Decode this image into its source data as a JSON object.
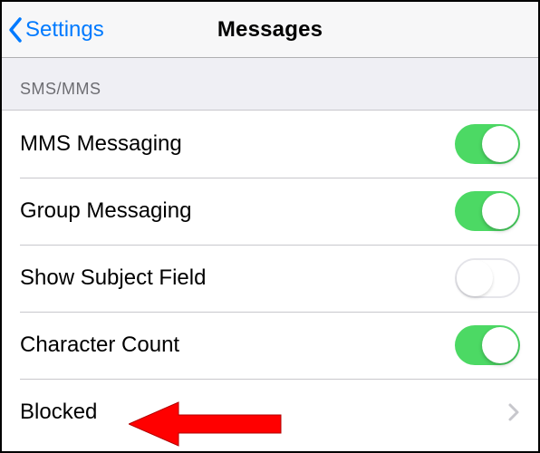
{
  "navbar": {
    "back_label": "Settings",
    "title": "Messages"
  },
  "section": {
    "header": "SMS/MMS"
  },
  "rows": {
    "mms": {
      "label": "MMS Messaging",
      "on": true
    },
    "group": {
      "label": "Group Messaging",
      "on": true
    },
    "subject": {
      "label": "Show Subject Field",
      "on": false
    },
    "charcount": {
      "label": "Character Count",
      "on": true
    },
    "blocked": {
      "label": "Blocked"
    }
  }
}
